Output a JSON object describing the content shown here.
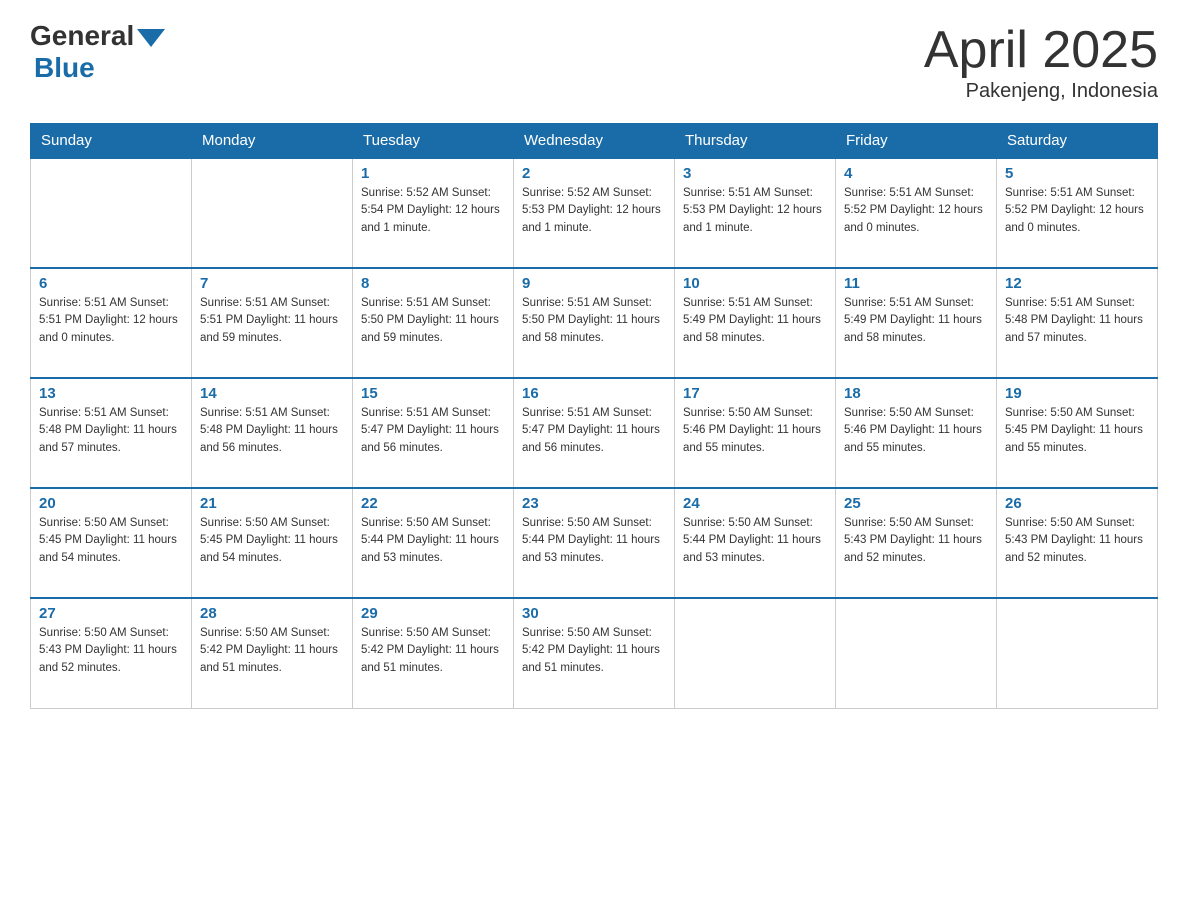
{
  "logo": {
    "general": "General",
    "blue": "Blue"
  },
  "title": "April 2025",
  "location": "Pakenjeng, Indonesia",
  "days_of_week": [
    "Sunday",
    "Monday",
    "Tuesday",
    "Wednesday",
    "Thursday",
    "Friday",
    "Saturday"
  ],
  "weeks": [
    [
      {
        "day": "",
        "info": ""
      },
      {
        "day": "",
        "info": ""
      },
      {
        "day": "1",
        "info": "Sunrise: 5:52 AM\nSunset: 5:54 PM\nDaylight: 12 hours\nand 1 minute."
      },
      {
        "day": "2",
        "info": "Sunrise: 5:52 AM\nSunset: 5:53 PM\nDaylight: 12 hours\nand 1 minute."
      },
      {
        "day": "3",
        "info": "Sunrise: 5:51 AM\nSunset: 5:53 PM\nDaylight: 12 hours\nand 1 minute."
      },
      {
        "day": "4",
        "info": "Sunrise: 5:51 AM\nSunset: 5:52 PM\nDaylight: 12 hours\nand 0 minutes."
      },
      {
        "day": "5",
        "info": "Sunrise: 5:51 AM\nSunset: 5:52 PM\nDaylight: 12 hours\nand 0 minutes."
      }
    ],
    [
      {
        "day": "6",
        "info": "Sunrise: 5:51 AM\nSunset: 5:51 PM\nDaylight: 12 hours\nand 0 minutes."
      },
      {
        "day": "7",
        "info": "Sunrise: 5:51 AM\nSunset: 5:51 PM\nDaylight: 11 hours\nand 59 minutes."
      },
      {
        "day": "8",
        "info": "Sunrise: 5:51 AM\nSunset: 5:50 PM\nDaylight: 11 hours\nand 59 minutes."
      },
      {
        "day": "9",
        "info": "Sunrise: 5:51 AM\nSunset: 5:50 PM\nDaylight: 11 hours\nand 58 minutes."
      },
      {
        "day": "10",
        "info": "Sunrise: 5:51 AM\nSunset: 5:49 PM\nDaylight: 11 hours\nand 58 minutes."
      },
      {
        "day": "11",
        "info": "Sunrise: 5:51 AM\nSunset: 5:49 PM\nDaylight: 11 hours\nand 58 minutes."
      },
      {
        "day": "12",
        "info": "Sunrise: 5:51 AM\nSunset: 5:48 PM\nDaylight: 11 hours\nand 57 minutes."
      }
    ],
    [
      {
        "day": "13",
        "info": "Sunrise: 5:51 AM\nSunset: 5:48 PM\nDaylight: 11 hours\nand 57 minutes."
      },
      {
        "day": "14",
        "info": "Sunrise: 5:51 AM\nSunset: 5:48 PM\nDaylight: 11 hours\nand 56 minutes."
      },
      {
        "day": "15",
        "info": "Sunrise: 5:51 AM\nSunset: 5:47 PM\nDaylight: 11 hours\nand 56 minutes."
      },
      {
        "day": "16",
        "info": "Sunrise: 5:51 AM\nSunset: 5:47 PM\nDaylight: 11 hours\nand 56 minutes."
      },
      {
        "day": "17",
        "info": "Sunrise: 5:50 AM\nSunset: 5:46 PM\nDaylight: 11 hours\nand 55 minutes."
      },
      {
        "day": "18",
        "info": "Sunrise: 5:50 AM\nSunset: 5:46 PM\nDaylight: 11 hours\nand 55 minutes."
      },
      {
        "day": "19",
        "info": "Sunrise: 5:50 AM\nSunset: 5:45 PM\nDaylight: 11 hours\nand 55 minutes."
      }
    ],
    [
      {
        "day": "20",
        "info": "Sunrise: 5:50 AM\nSunset: 5:45 PM\nDaylight: 11 hours\nand 54 minutes."
      },
      {
        "day": "21",
        "info": "Sunrise: 5:50 AM\nSunset: 5:45 PM\nDaylight: 11 hours\nand 54 minutes."
      },
      {
        "day": "22",
        "info": "Sunrise: 5:50 AM\nSunset: 5:44 PM\nDaylight: 11 hours\nand 53 minutes."
      },
      {
        "day": "23",
        "info": "Sunrise: 5:50 AM\nSunset: 5:44 PM\nDaylight: 11 hours\nand 53 minutes."
      },
      {
        "day": "24",
        "info": "Sunrise: 5:50 AM\nSunset: 5:44 PM\nDaylight: 11 hours\nand 53 minutes."
      },
      {
        "day": "25",
        "info": "Sunrise: 5:50 AM\nSunset: 5:43 PM\nDaylight: 11 hours\nand 52 minutes."
      },
      {
        "day": "26",
        "info": "Sunrise: 5:50 AM\nSunset: 5:43 PM\nDaylight: 11 hours\nand 52 minutes."
      }
    ],
    [
      {
        "day": "27",
        "info": "Sunrise: 5:50 AM\nSunset: 5:43 PM\nDaylight: 11 hours\nand 52 minutes."
      },
      {
        "day": "28",
        "info": "Sunrise: 5:50 AM\nSunset: 5:42 PM\nDaylight: 11 hours\nand 51 minutes."
      },
      {
        "day": "29",
        "info": "Sunrise: 5:50 AM\nSunset: 5:42 PM\nDaylight: 11 hours\nand 51 minutes."
      },
      {
        "day": "30",
        "info": "Sunrise: 5:50 AM\nSunset: 5:42 PM\nDaylight: 11 hours\nand 51 minutes."
      },
      {
        "day": "",
        "info": ""
      },
      {
        "day": "",
        "info": ""
      },
      {
        "day": "",
        "info": ""
      }
    ]
  ]
}
